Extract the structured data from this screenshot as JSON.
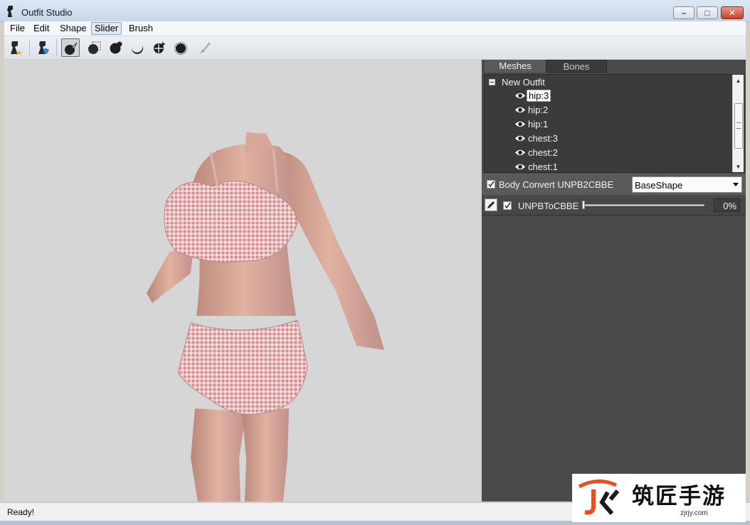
{
  "window": {
    "title": "Outfit Studio",
    "min": "–",
    "max": "□",
    "close": "✕"
  },
  "menu": [
    "File",
    "Edit",
    "Shape",
    "Slider",
    "Brush"
  ],
  "menu_active": "Slider",
  "toolbar": {
    "tools": [
      "load-outfit-icon",
      "load-reference-icon",
      "select-brush-icon",
      "mask-brush-icon",
      "inflate-brush-icon",
      "deflate-brush-icon",
      "move-brush-icon",
      "smooth-brush-icon",
      "weight-brush-icon"
    ],
    "active_tool": "select-brush-icon"
  },
  "tabs": {
    "meshes": "Meshes",
    "bones": "Bones"
  },
  "tree": {
    "root": "New Outfit",
    "items": [
      "hip:3",
      "hip:2",
      "hip:1",
      "chest:3",
      "chest:2",
      "chest:1"
    ],
    "selected": "hip:3"
  },
  "conversion": {
    "label": "Body Convert UNPB2CBBE",
    "checked": true,
    "shape": "BaseShape"
  },
  "slider": {
    "name": "UNPBToCBBE",
    "checked": true,
    "value": 0,
    "display": "0%"
  },
  "status": {
    "text": "Ready!"
  },
  "watermark": {
    "text": "筑匠手游",
    "url": "zjrjy.com"
  },
  "colors": {
    "panel_bg": "#4a4a4a",
    "viewport_bg": "#d5d6d5",
    "close_red": "#c7402a"
  }
}
